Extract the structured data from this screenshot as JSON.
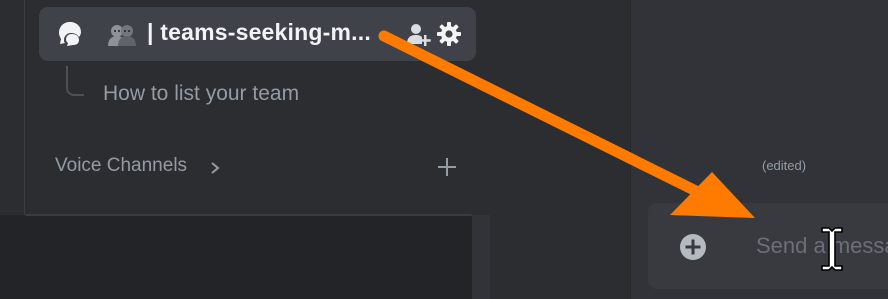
{
  "sidebar": {
    "active_channel": {
      "name": "teams-seeking-m...",
      "thread_icon": "threads-icon",
      "emoji_icon": "two-people-emoji-icon",
      "add_member_icon": "add-member-icon",
      "settings_icon": "gear-icon"
    },
    "thread": {
      "title": "How to list your team"
    },
    "voice_category": {
      "label": "Voice Channels",
      "chevron_icon": "chevron-right-icon",
      "add_icon": "plus-icon"
    }
  },
  "chat": {
    "edited_label": "(edited)",
    "composer": {
      "placeholder": "Send a message",
      "add_icon": "plus-circle-icon"
    }
  },
  "overlay": {
    "pointer": "i-beam-cursor-icon",
    "annotation": "orange-arrow",
    "annotation_color": "#ff7b00"
  },
  "colors": {
    "sidebar_bg": "#2b2d31",
    "chat_bg": "#313338",
    "active_row_bg": "#404249",
    "text_primary": "#f2f3f5",
    "text_muted": "#949ba4"
  }
}
